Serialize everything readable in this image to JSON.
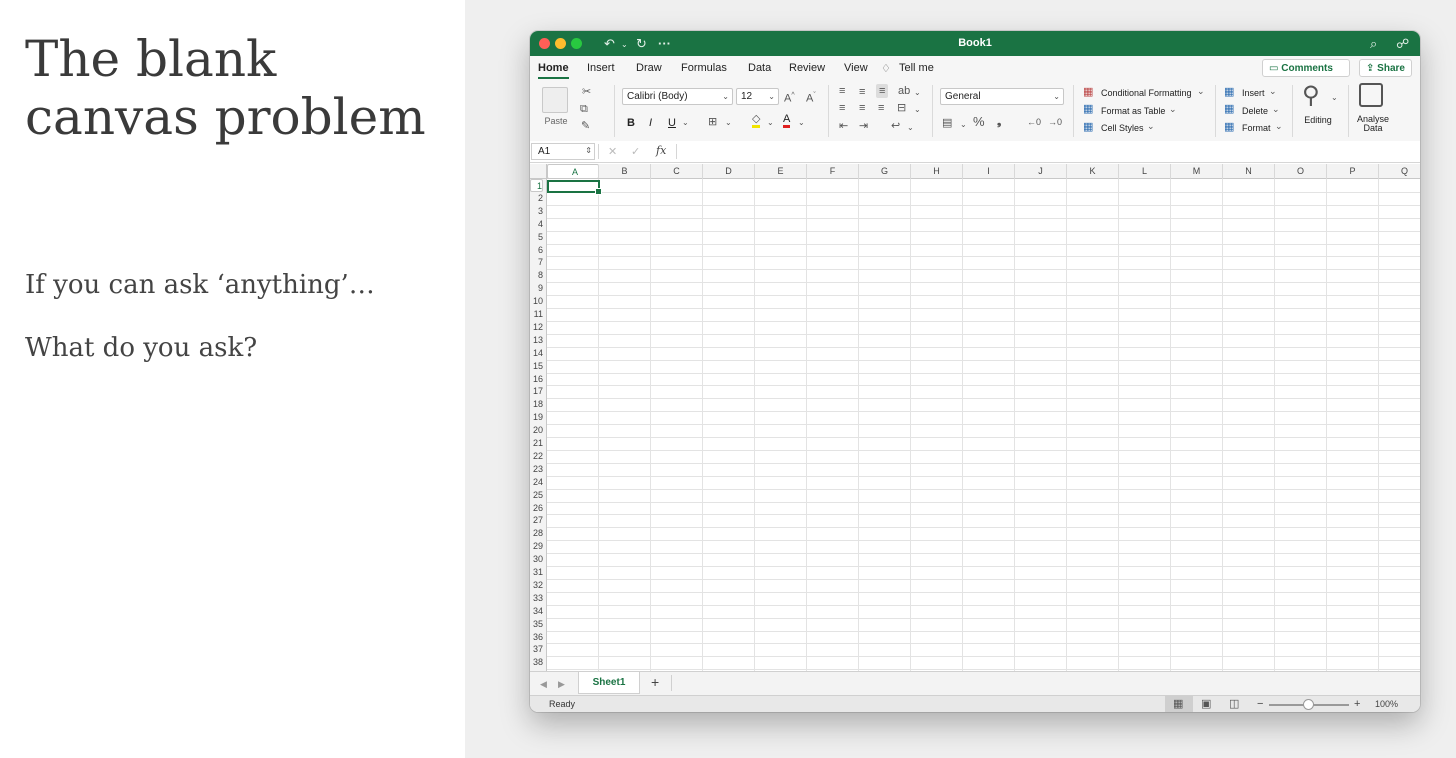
{
  "slide": {
    "title_line1": "The blank",
    "title_line2": "canvas problem",
    "question1": "If you can ask ‘anything’…",
    "question2": "What do you ask?"
  },
  "colors": {
    "excel_green": "#1a7343",
    "close": "#ff5f57",
    "minimize": "#febc2e",
    "zoom": "#28c840"
  },
  "window": {
    "title": "Book1",
    "titlebar_icons": [
      "undo-icon",
      "chevron-down-icon",
      "redo-icon",
      "more-icon",
      "search-icon",
      "share-people-icon"
    ]
  },
  "tabs": [
    {
      "label": "Home",
      "active": true
    },
    {
      "label": "Insert"
    },
    {
      "label": "Draw"
    },
    {
      "label": "Formulas"
    },
    {
      "label": "Data"
    },
    {
      "label": "Review"
    },
    {
      "label": "View"
    }
  ],
  "tell_me": "Tell me",
  "comments_label": "Comments",
  "share_label": "Share",
  "ribbon": {
    "paste_label": "Paste",
    "font_name": "Calibri (Body)",
    "font_size": "12",
    "bold": "B",
    "italic": "I",
    "underline": "U",
    "fill_glyph": "◇",
    "font_color_glyph": "A",
    "number_format": "General",
    "percent": "%",
    "comma": "❟",
    "conditional_formatting": "Conditional Formatting",
    "format_as_table": "Format as Table",
    "cell_styles": "Cell Styles",
    "insert": "Insert",
    "delete": "Delete",
    "format": "Format",
    "editing": "Editing",
    "analyse_line1": "Analyse",
    "analyse_line2": "Data"
  },
  "formula_bar": {
    "name_box": "A1",
    "fx": "fx",
    "value": ""
  },
  "grid": {
    "columns": [
      "A",
      "B",
      "C",
      "D",
      "E",
      "F",
      "G",
      "H",
      "I",
      "J",
      "K",
      "L",
      "M",
      "N",
      "O",
      "P",
      "Q"
    ],
    "rows": [
      "1",
      "2",
      "3",
      "4",
      "5",
      "6",
      "7",
      "8",
      "9",
      "10",
      "11",
      "12",
      "13",
      "14",
      "15",
      "16",
      "17",
      "18",
      "19",
      "20",
      "21",
      "22",
      "23",
      "24",
      "25",
      "26",
      "27",
      "28",
      "29",
      "30",
      "31",
      "32",
      "33",
      "34",
      "35",
      "36",
      "37",
      "38"
    ],
    "selected_cell": "A1"
  },
  "sheets": [
    {
      "label": "Sheet1",
      "active": true
    }
  ],
  "add_sheet": "+",
  "status": {
    "ready": "Ready",
    "zoom_minus": "−",
    "zoom_plus": "+",
    "zoom": "100%"
  }
}
